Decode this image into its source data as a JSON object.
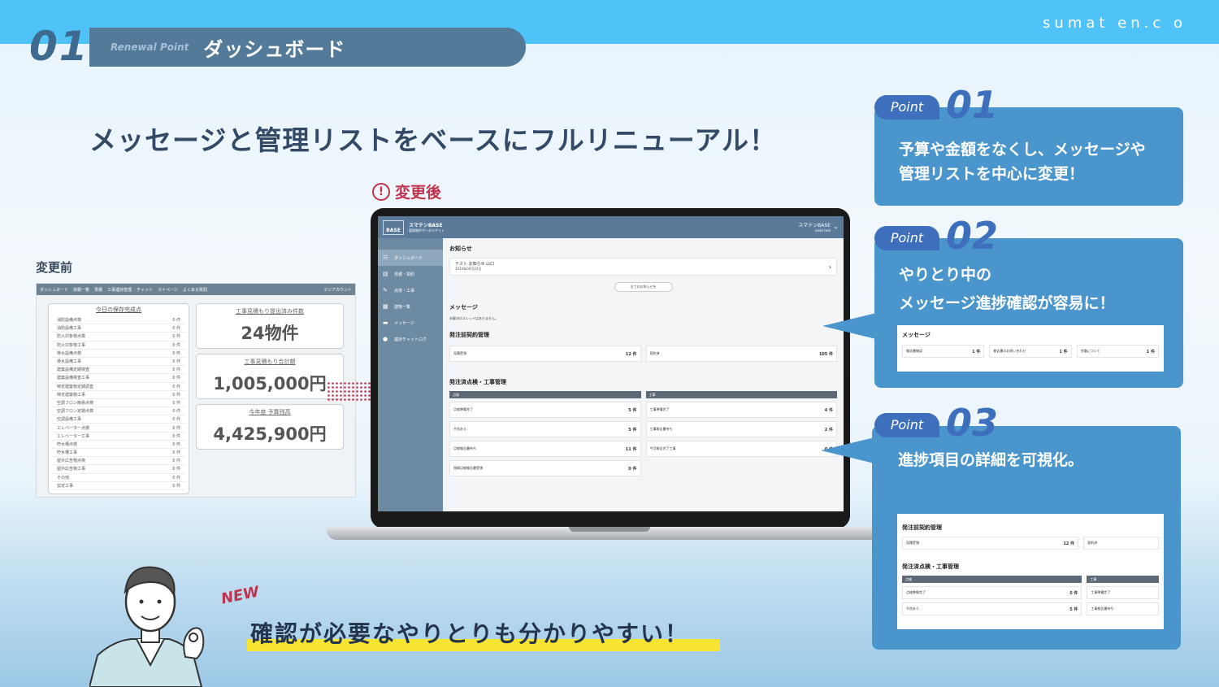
{
  "brand": "sumat en.c o",
  "slide_number": "01",
  "header": {
    "renewal_point": "Renewal Point",
    "title": "ダッシュボード"
  },
  "headline": "メッセージと管理リストをベースにフルリニューアル！",
  "before": {
    "label": "変更前",
    "nav": [
      "ダッシュボード",
      "依頼一覧",
      "見積",
      "工事進捗管理",
      "チャット",
      "マイページ",
      "よくある質問",
      "マジアカウント"
    ],
    "list_title": "今日の保存完成点",
    "list_rows": [
      {
        "name": "消防設備点検",
        "count": "0 件"
      },
      {
        "name": "消防設備工事",
        "count": "0 件"
      },
      {
        "name": "防火対象物点検",
        "count": "0 件"
      },
      {
        "name": "防火対象物工事",
        "count": "0 件"
      },
      {
        "name": "排水設備点検",
        "count": "0 件"
      },
      {
        "name": "排水設備工事",
        "count": "0 件"
      },
      {
        "name": "建築設備定期検査",
        "count": "0 件"
      },
      {
        "name": "建築設備検査工事",
        "count": "0 件"
      },
      {
        "name": "特定建築物定期調査",
        "count": "0 件"
      },
      {
        "name": "特定建築物工事",
        "count": "0 件"
      },
      {
        "name": "空調フロン簡易点検",
        "count": "0 件"
      },
      {
        "name": "空調フロン定期点検",
        "count": "0 件"
      },
      {
        "name": "空調設備工事",
        "count": "0 件"
      },
      {
        "name": "エレベーター点検",
        "count": "0 件"
      },
      {
        "name": "エレベーター工事",
        "count": "0 件"
      },
      {
        "name": "貯水槽点検",
        "count": "0 件"
      },
      {
        "name": "貯水槽工事",
        "count": "0 件"
      },
      {
        "name": "屋外広告物点検",
        "count": "0 件"
      },
      {
        "name": "屋外広告物工事",
        "count": "0 件"
      },
      {
        "name": "その他",
        "count": "0 件"
      },
      {
        "name": "剪定工事",
        "count": "0 件"
      }
    ],
    "boxes": [
      {
        "label": "工事見積もり提出済み件数",
        "value": "24物件"
      },
      {
        "label": "工事見積もり合計額",
        "value": "1,005,000円"
      },
      {
        "label": "今年度 予算残高",
        "value": "4,425,900円"
      }
    ]
  },
  "after": {
    "label": "変更後",
    "app_title": "スマテンBASE",
    "app_subtitle": "管理物件ポータルサイト",
    "logo": "BASE",
    "user_name": "スマテンBASE",
    "user_sub": "ando test",
    "sidebar": [
      {
        "icon": "☷",
        "label": "ダッシュボード",
        "active": true
      },
      {
        "icon": "▤",
        "label": "見積・契約",
        "active": false
      },
      {
        "icon": "✎",
        "label": "点検・工事",
        "active": false
      },
      {
        "icon": "▦",
        "label": "建物一覧",
        "active": false
      },
      {
        "icon": "▬",
        "label": "メッセージ",
        "active": false
      },
      {
        "icon": "●",
        "label": "進捗チャットログ",
        "active": false
      }
    ],
    "news_heading": "お知らせ",
    "news_title": "テスト お知らせ 山口",
    "news_date": "2024年06月22日",
    "all_news_button": "全てのお知らせを",
    "messages_heading": "メッセージ",
    "messages_note": "未解決のスレッドはありません。",
    "pre_contract_heading": "発注前契約管理",
    "pre_contract": [
      {
        "label": "見積受領",
        "value": "12 件"
      },
      {
        "label": "契約済",
        "value": "105 件"
      }
    ],
    "ordered_heading": "発注済点検・工事管理",
    "inspection_header": "点検",
    "construction_header": "工事",
    "inspection_rows": [
      {
        "label": "点検準備完了",
        "value": "5 件"
      },
      {
        "label": "不良あり",
        "value": "5 件"
      },
      {
        "label": "点検報告書待ち",
        "value": "11 件"
      },
      {
        "label": "指摘点検報告書受領",
        "value": "0 件"
      }
    ],
    "construction_rows": [
      {
        "label": "工事準備完了",
        "value": "4 件"
      },
      {
        "label": "工事報告書待ち",
        "value": "2 件"
      },
      {
        "label": "今月報告完了工事",
        "value": "0 件"
      }
    ]
  },
  "points": [
    {
      "pill": "Point",
      "number": "01",
      "text_lines": [
        "予算や金額をなくし、メッセージや",
        "管理リストを中心に変更！"
      ]
    },
    {
      "pill": "Point",
      "number": "02",
      "text_lines": [
        "やりとり中の",
        "メッセージ進捗確認が容易に！"
      ],
      "mini_heading": "メッセージ",
      "mini_items": [
        {
          "label": "報告書確認",
          "value": "1 件"
        },
        {
          "label": "報告書のお問い合わせ",
          "value": "1 件"
        },
        {
          "label": "労働について",
          "value": "1 件"
        }
      ]
    },
    {
      "pill": "Point",
      "number": "03",
      "text_lines": [
        "進捗項目の詳細を可視化。"
      ],
      "mini_heading1": "発注前契約管理",
      "mini_pre": [
        {
          "label": "見積受領",
          "value": "12 件"
        },
        {
          "label": "契約済",
          "value": ""
        }
      ],
      "mini_heading2": "発注済点検・工事管理",
      "mini_col1": "点検",
      "mini_col2": "工事",
      "mini_rows1": [
        {
          "label": "点検準備完了",
          "value": "5 件"
        },
        {
          "label": "不良あり",
          "value": "5 件"
        }
      ],
      "mini_rows2": [
        {
          "label": "工事準備完了",
          "value": ""
        },
        {
          "label": "工事報告書待ち",
          "value": ""
        }
      ]
    }
  ],
  "new_tag": "NEW",
  "bottom_text": "確認が必要なやりとりも分かりやすい！",
  "colors": {
    "accent_blue": "#4fc3f7",
    "panel_blue": "#4a96cc",
    "point_blue": "#3d6fbd",
    "alert_red": "#c0334d",
    "highlight_yellow": "#f7e531"
  }
}
